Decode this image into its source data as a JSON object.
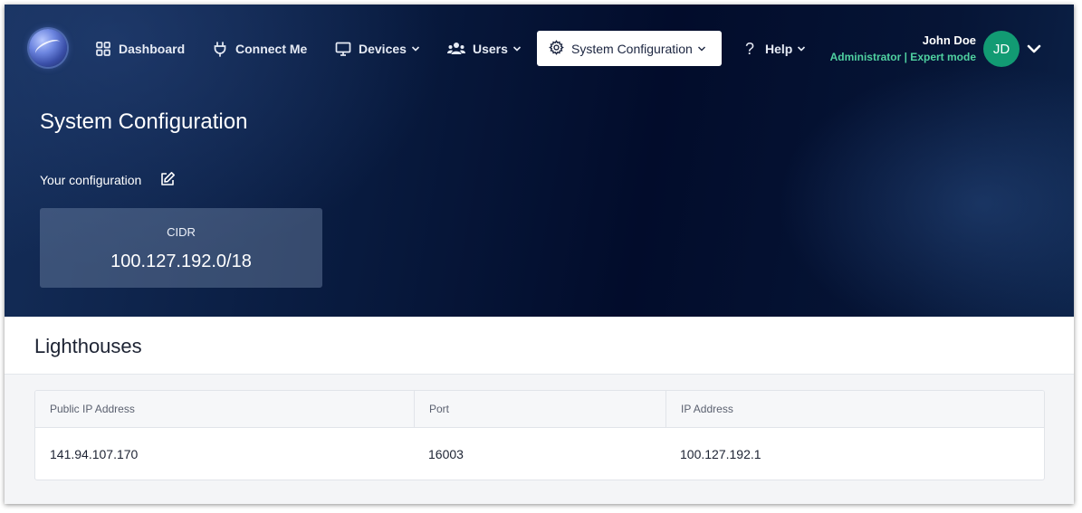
{
  "nav": {
    "items": [
      {
        "label": "Dashboard",
        "icon": "grid-icon"
      },
      {
        "label": "Connect Me",
        "icon": "plug-icon"
      },
      {
        "label": "Devices",
        "icon": "monitor-icon",
        "dropdown": true
      },
      {
        "label": "Users",
        "icon": "users-icon",
        "dropdown": true
      },
      {
        "label": "System Configuration",
        "icon": "gear-icon",
        "dropdown": true,
        "active": true
      },
      {
        "label": "Help",
        "icon": "question-icon",
        "dropdown": true
      }
    ]
  },
  "user": {
    "name": "John Doe",
    "role": "Administrator | Expert mode",
    "initials": "JD",
    "avatar_color": "#129b73"
  },
  "page": {
    "title": "System Configuration",
    "config_label": "Your configuration"
  },
  "cidr": {
    "label": "CIDR",
    "value": "100.127.192.0/18"
  },
  "lighthouses": {
    "title": "Lighthouses",
    "columns": [
      "Public IP Address",
      "Port",
      "IP Address"
    ],
    "rows": [
      [
        "141.94.107.170",
        "16003",
        "100.127.192.1"
      ]
    ]
  },
  "colors": {
    "accent_green": "#4fd1a0",
    "header_dark": "#020c2b"
  }
}
